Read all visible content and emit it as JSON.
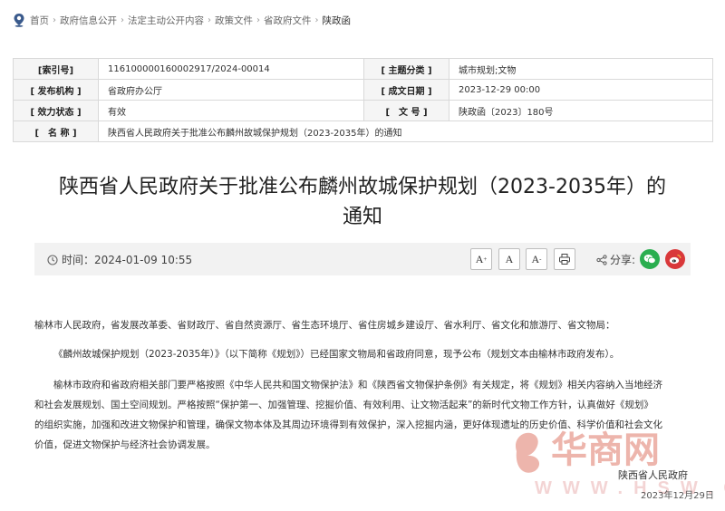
{
  "breadcrumb": {
    "items": [
      "首页",
      "政府信息公开",
      "法定主动公开内容",
      "政策文件",
      "省政府文件",
      "陕政函"
    ],
    "separator": "›"
  },
  "meta": {
    "index_no_label": "[索引号]",
    "index_no": "116100000160002917/2024-00014",
    "category_label": "[ 主题分类 ]",
    "category": "城市规划;文物",
    "publisher_label": "[ 发布机构 ]",
    "publisher": "省政府办公厅",
    "date_label": "[ 成文日期 ]",
    "date": "2023-12-29 00:00",
    "status_label": "[ 效力状态 ]",
    "status": "有效",
    "docno_label": "[　文 号 ]",
    "docno": "陕政函〔2023〕180号",
    "name_label": "[　名 称 ]",
    "name": "陕西省人民政府关于批准公布麟州故城保护规划（2023-2035年）的通知"
  },
  "title_line1": "陕西省人民政府关于批准公布麟州故城保护规划（2023-2035年）的",
  "title_line2": "通知",
  "toolbar": {
    "time": "时间：2024-01-09 10:55",
    "font_up": "A",
    "font_normal": "A",
    "font_down": "A",
    "share_label": "分享:"
  },
  "body": {
    "p1": "榆林市人民政府，省发展改革委、省财政厅、省自然资源厅、省生态环境厅、省住房城乡建设厅、省水利厅、省文化和旅游厅、省文物局：",
    "p2": "《麟州故城保护规划（2023-2035年）》（以下简称《规划》）已经国家文物局和省政府同意，现予公布（规划文本由榆林市政府发布）。",
    "p3a": "榆林市政府和省政府相关部门要严格按照《中华人民共和国文物保护法》和《陕西省文物保护条例》有关规定，将《规划》相关内容纳入当地经济",
    "p3b": "和社会发展规划、国土空间规划。严格按照“保护第一、加强管理、挖掘价值、有效利用、让文物活起来”的新时代文物工作方针，认真做好《规划》",
    "p3c": "的组织实施，加强和改进文物保护和管理，确保文物本体及其周边环境得到有效保护，深入挖掘内涵，更好体现遗址的历史价值、科学价值和社会文化",
    "p3d": "价值，促进文物保护与经济社会协调发展。"
  },
  "signature": {
    "org": "陕西省人民政府",
    "date": "2023年12月29日"
  },
  "watermark": {
    "logo": "华商网",
    "url": "WWW.HSW.CN"
  },
  "colors": {
    "wechat": "#2aae4f",
    "weibo": "#d9383a",
    "watermark": "#e07a6a"
  }
}
